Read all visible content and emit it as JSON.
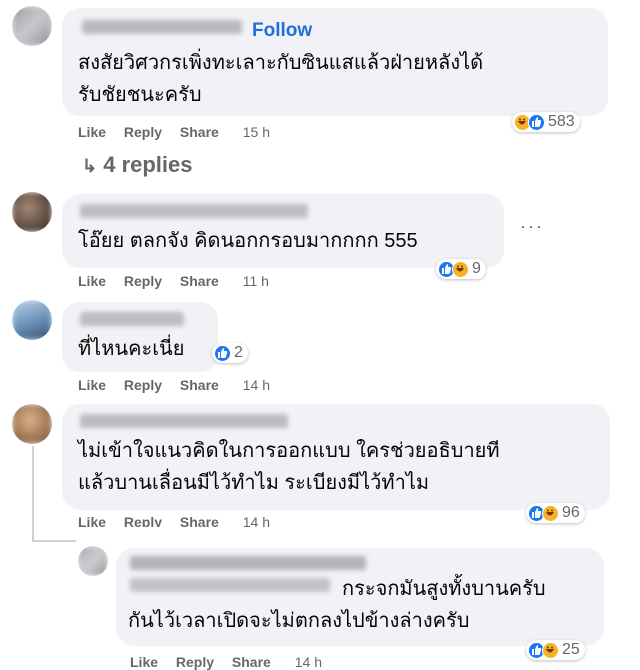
{
  "comments": [
    {
      "follow": "Follow",
      "line1": "สงสัยวิศวกรเพิ่งทะเลาะกับซินแสแล้วฝ่ายหลังได้",
      "line2": "รับชัยชนะครับ",
      "actions": {
        "like": "Like",
        "reply": "Reply",
        "share": "Share",
        "time": "15 h"
      },
      "reaction_count": "583",
      "reaction_icons": [
        "haha-icon",
        "like-icon"
      ],
      "replies_label": "4 replies"
    },
    {
      "line1": "โอ๊ยย ตลกจัง คิดนอกกรอบมากกกก 555",
      "actions": {
        "like": "Like",
        "reply": "Reply",
        "share": "Share",
        "time": "11 h"
      },
      "reaction_count": "9",
      "reaction_icons": [
        "like-icon",
        "haha-icon"
      ]
    },
    {
      "line1": "ที่ไหนคะเนี่ย",
      "actions": {
        "like": "Like",
        "reply": "Reply",
        "share": "Share",
        "time": "14 h"
      },
      "reaction_count": "2",
      "reaction_icons": [
        "like-icon"
      ]
    },
    {
      "line1": "ไม่เข้าใจแนวคิดในการออกแบบ ใครช่วยอธิบายที",
      "line2": "แล้วบานเลื่อนมีไว้ทำไม ระเบียงมีไว้ทำไม",
      "actions": {
        "like": "Like",
        "reply": "Reply",
        "share": "Share",
        "time": "14 h"
      },
      "reaction_count": "96",
      "reaction_icons": [
        "like-icon",
        "haha-icon"
      ]
    },
    {
      "line1": "กระจกมันสูงทั้งบานครับ",
      "line2": "กันไว้เวลาเปิดจะไม่ตกลงไปข้างล่างครับ",
      "actions": {
        "like": "Like",
        "reply": "Reply",
        "share": "Share",
        "time": "14 h"
      },
      "reaction_count": "25",
      "reaction_icons": [
        "like-icon",
        "haha-icon"
      ]
    }
  ],
  "colors": {
    "accent": "#216fdb",
    "bubble": "#f0f2f5",
    "muted": "#65676b",
    "like": "#1877f2",
    "haha": "#f7b125"
  }
}
